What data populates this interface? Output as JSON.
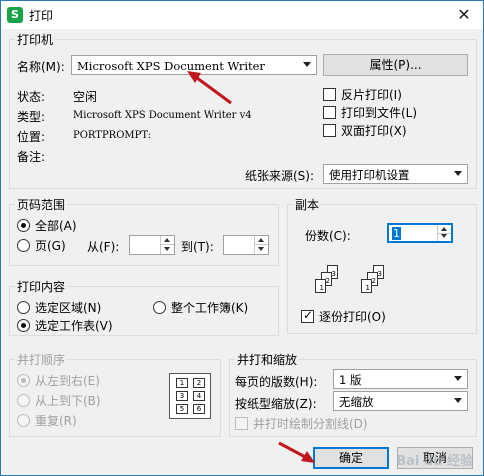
{
  "window": {
    "title": "打印",
    "app_icon": "S",
    "close_glyph": "✕"
  },
  "printer": {
    "group_title": "打印机",
    "name_label": "名称(M):",
    "name_value": "Microsoft XPS Document Writer",
    "properties_button": "属性(P)...",
    "status_label": "状态:",
    "status_value": "空闲",
    "type_label": "类型:",
    "type_value": "Microsoft XPS Document Writer v4",
    "location_label": "位置:",
    "location_value": "PORTPROMPT:",
    "comment_label": "备注:",
    "reverse_print": "反片打印(I)",
    "print_to_file": "打印到文件(L)",
    "duplex": "双面打印(X)",
    "paper_source_label": "纸张来源(S):",
    "paper_source_value": "使用打印机设置"
  },
  "page_range": {
    "group_title": "页码范围",
    "all": "全部(A)",
    "pages": "页(G)",
    "from_label": "从(F):",
    "to_label": "到(T):"
  },
  "copies": {
    "group_title": "副本",
    "count_label": "份数(C):",
    "count_value": "1",
    "collate": "逐份打印(O)",
    "page_numbers": [
      "1",
      "2",
      "3"
    ]
  },
  "print_content": {
    "group_title": "打印内容",
    "selection": "选定区域(N)",
    "entire_workbook": "整个工作簿(K)",
    "selected_sheets": "选定工作表(V)"
  },
  "order": {
    "group_title": "并打顺序",
    "left_to_right": "从左到右(E)",
    "top_to_bottom": "从上到下(B)",
    "repeat": "重复(R)",
    "cells": [
      "1",
      "2",
      "3",
      "4",
      "5",
      "6"
    ]
  },
  "scaling": {
    "group_title": "并打和缩放",
    "pages_per_sheet_label": "每页的版数(H):",
    "pages_per_sheet_value": "1 版",
    "scale_to_paper_label": "按纸型缩放(Z):",
    "scale_to_paper_value": "无缩放",
    "draw_borders": "并打时绘制分割线(D)"
  },
  "buttons": {
    "ok": "确定",
    "cancel": "取消"
  },
  "watermark": "Bai du 经验",
  "colors": {
    "accent": "#0078d7",
    "arrow": "#c0161c"
  }
}
